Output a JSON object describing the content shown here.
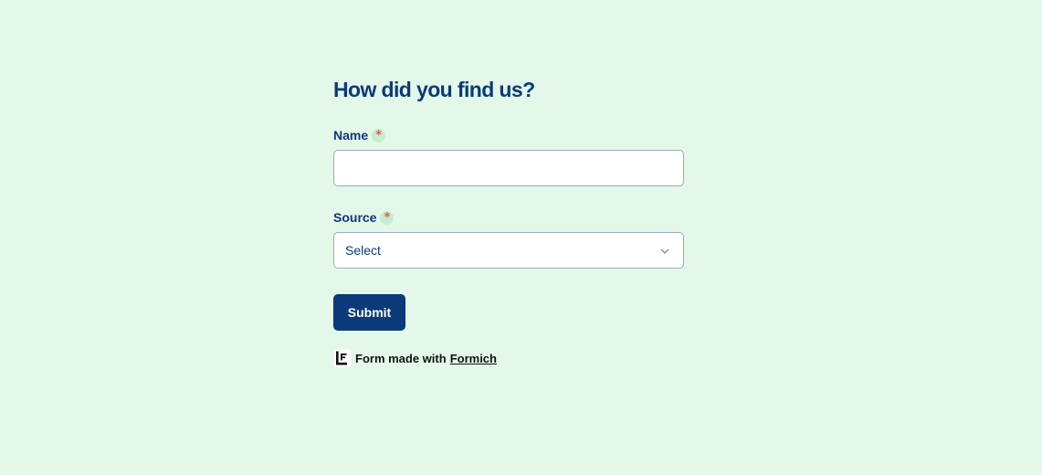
{
  "form": {
    "title": "How did you find us?",
    "fields": {
      "name": {
        "label": "Name",
        "required_mark": "*",
        "value": "",
        "placeholder": ""
      },
      "source": {
        "label": "Source",
        "required_mark": "*",
        "selected": "Select"
      }
    },
    "submit_label": "Submit"
  },
  "footer": {
    "text": "Form made with",
    "link_text": "Formich",
    "logo_icon": "formich-logo-icon"
  },
  "colors": {
    "background": "#e3f8e9",
    "primary": "#0b3a78",
    "required": "#e25b4d",
    "input_border": "#9aaac4"
  }
}
